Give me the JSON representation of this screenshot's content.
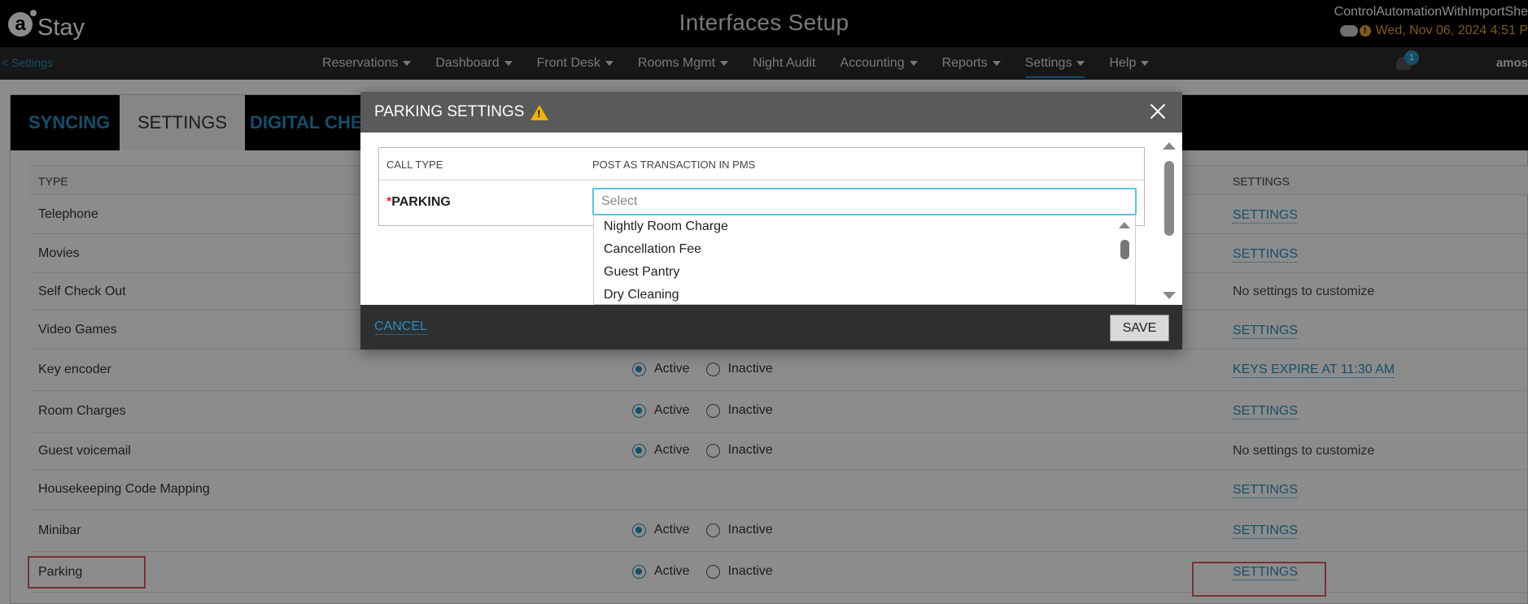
{
  "header": {
    "logo_text": "Stay",
    "app_title": "Interfaces Setup",
    "user_name": "ControlAutomationWithImportShe",
    "datetime": "Wed, Nov 06, 2024 4:51 P"
  },
  "nav": {
    "back_label": "< Settings",
    "items": [
      {
        "label": "Reservations",
        "dropdown": true
      },
      {
        "label": "Dashboard",
        "dropdown": true
      },
      {
        "label": "Front Desk",
        "dropdown": true
      },
      {
        "label": "Rooms Mgmt",
        "dropdown": true
      },
      {
        "label": "Night Audit",
        "dropdown": false
      },
      {
        "label": "Accounting",
        "dropdown": true
      },
      {
        "label": "Reports",
        "dropdown": true
      },
      {
        "label": "Settings",
        "dropdown": true
      },
      {
        "label": "Help",
        "dropdown": true
      }
    ],
    "active_item": "Settings",
    "notification_count": "1",
    "user_short": "amos"
  },
  "tabs": [
    {
      "label": "SYNCING"
    },
    {
      "label": "SETTINGS"
    },
    {
      "label": "DIGITAL CHEC"
    }
  ],
  "table": {
    "col_type": "TYPE",
    "col_settings": "SETTINGS",
    "active_label": "Active",
    "inactive_label": "Inactive",
    "rows": [
      {
        "type": "Telephone",
        "settings": "SETTINGS"
      },
      {
        "type": "Movies",
        "settings": "SETTINGS"
      },
      {
        "type": "Self Check Out",
        "settings": "No settings to customize"
      },
      {
        "type": "Video Games",
        "settings": "SETTINGS"
      },
      {
        "type": "Key encoder",
        "settings": "KEYS EXPIRE AT 11:30 AM"
      },
      {
        "type": "Room Charges",
        "settings": "SETTINGS"
      },
      {
        "type": "Guest voicemail",
        "settings": "No settings to customize"
      },
      {
        "type": "Housekeeping Code Mapping",
        "settings": "SETTINGS"
      },
      {
        "type": "Minibar",
        "settings": "SETTINGS"
      },
      {
        "type": "Parking",
        "settings": "SETTINGS"
      }
    ]
  },
  "modal": {
    "title": "PARKING SETTINGS",
    "col_call_type": "CALL TYPE",
    "col_post": "POST AS TRANSACTION IN PMS",
    "required_mark": "*",
    "row_label": "PARKING",
    "select_placeholder": "Select",
    "options": [
      "Nightly Room Charge",
      "Cancellation Fee",
      "Guest Pantry",
      "Dry Cleaning"
    ],
    "cancel_label": "CANCEL",
    "save_label": "SAVE"
  },
  "colors": {
    "accent": "#2a8fc4",
    "warning": "#f0b400",
    "highlight": "#e05a5a"
  }
}
